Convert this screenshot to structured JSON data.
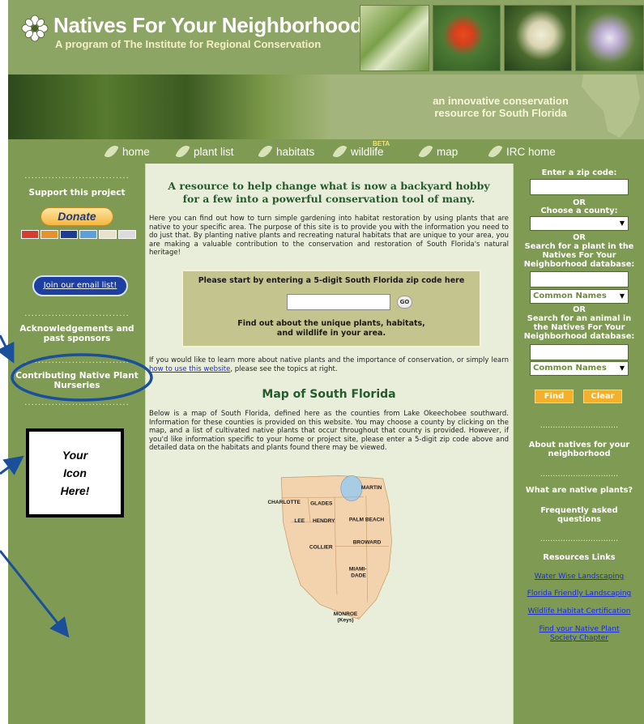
{
  "header": {
    "site_title": "Natives For Your Neighborhood",
    "site_subtitle": "A program of The Institute for Regional Conservation",
    "tagline_line1": "an innovative conservation",
    "tagline_line2": "resource for South Florida"
  },
  "nav": {
    "items": [
      {
        "label": "home"
      },
      {
        "label": "plant list"
      },
      {
        "label": "habitats"
      },
      {
        "label": "wildlife",
        "badge": "BETA"
      },
      {
        "label": "map"
      },
      {
        "label": "IRC home"
      }
    ]
  },
  "left": {
    "divider": "...............................",
    "support": "Support this project",
    "donate": "Donate",
    "email": "Join our email list!",
    "ack_line1": "Acknowledgements and",
    "ack_line2": "past sponsors",
    "nurseries_line1": "Contributing Native Plant",
    "nurseries_line2": "Nurseries"
  },
  "annotation": {
    "line1": "Your",
    "line2": "Icon",
    "line3": "Here!"
  },
  "main": {
    "heading_line1": "A resource to help change what is now a backyard hobby",
    "heading_line2": "for a few into a powerful conservation tool of many.",
    "intro": "Here you can find out how to turn simple gardening into habitat restoration by using plants that are native to your specific area. The purpose of this site is to provide you with the information you need to do just that. By planting native plants and recreating natural habitats that are unique to your area, you are making a valuable contribution to the conservation and restoration of South Florida's natural heritage!",
    "zip_title": "Please start by entering a 5-digit South Florida zip code here",
    "go": "GO",
    "zip_desc_line1": "Find out about the unique plants, habitats,",
    "zip_desc_line2": "and wildlife in your area.",
    "more_before": "If you would like to learn more about native plants and the importance of conservation, or simply learn ",
    "more_link": "how to use this website",
    "more_after": ", please see the topics at right.",
    "map_heading": "Map of South Florida",
    "map_desc": "Below is a map of South Florida, defined here as the counties from Lake Okeechobee southward. Information for these counties is provided on this website. You may choose a county by clicking on the map, and a list of cultivated native plants that occur throughout that county is provided. However, if you'd like information specific to your home or project site, please enter a 5-digit zip code above and detailed data on the habitats and plants found there may be viewed."
  },
  "map": {
    "counties": [
      "MARTIN",
      "CHARLOTTE",
      "GLADES",
      "LEE",
      "HENDRY",
      "PALM BEACH",
      "BROWARD",
      "COLLIER",
      "MIAMI-",
      "DADE",
      "MONROE",
      "(Keys)"
    ]
  },
  "right": {
    "zip_label": "Enter a zip code:",
    "or1": "OR",
    "county_label": "Choose a county:",
    "or2": "OR",
    "plant_line1": "Search for a plant in the",
    "plant_line2": "Natives For Your",
    "plant_line3": "Neighborhood database:",
    "plant_select": "Common Names",
    "or3": "OR",
    "animal_line1": "Search for an animal in",
    "animal_line2": "the Natives For Your",
    "animal_line3": "Neighborhood database:",
    "animal_select": "Common Names",
    "find": "Find",
    "clear": "Clear",
    "divider": "...............................",
    "about_line1": "About natives for your",
    "about_line2": "neighborhood",
    "what_are": "What are native plants?",
    "faq_line1": "Frequently asked",
    "faq_line2": "questions",
    "resources": "Resources Links",
    "links": [
      "Water Wise Landscaping",
      "Florida Friendly Landscaping",
      "Wildlife Habitat Certification",
      "Find your Native Plant",
      "Society Chapter"
    ]
  },
  "colors": {
    "sidebar_green": "#7f9a52",
    "page_bg": "#e9eedb",
    "heading_green": "#235b2a",
    "annotation_blue": "#1a4f9c",
    "button_orange": "#f4b02b"
  }
}
